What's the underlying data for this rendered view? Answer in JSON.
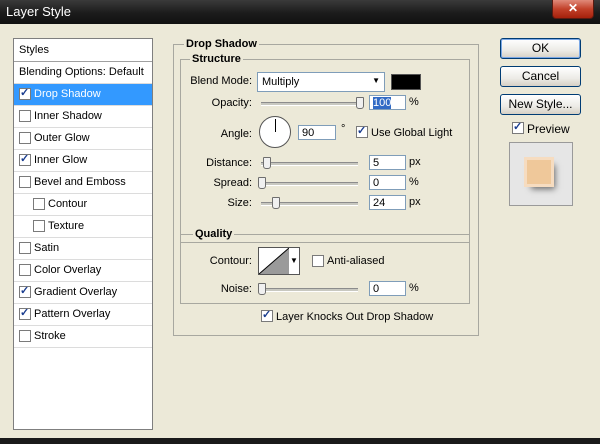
{
  "window": {
    "title": "Layer Style",
    "close_glyph": "✕"
  },
  "styles_panel": {
    "header": "Styles",
    "items": [
      {
        "label": "Blending Options: Default",
        "checkbox": false,
        "checked": false,
        "selected": false,
        "indent": 0
      },
      {
        "label": "Drop Shadow",
        "checkbox": true,
        "checked": true,
        "selected": true,
        "indent": 0
      },
      {
        "label": "Inner Shadow",
        "checkbox": true,
        "checked": false,
        "selected": false,
        "indent": 0
      },
      {
        "label": "Outer Glow",
        "checkbox": true,
        "checked": false,
        "selected": false,
        "indent": 0
      },
      {
        "label": "Inner Glow",
        "checkbox": true,
        "checked": true,
        "selected": false,
        "indent": 0
      },
      {
        "label": "Bevel and Emboss",
        "checkbox": true,
        "checked": false,
        "selected": false,
        "indent": 0
      },
      {
        "label": "Contour",
        "checkbox": true,
        "checked": false,
        "selected": false,
        "indent": 1
      },
      {
        "label": "Texture",
        "checkbox": true,
        "checked": false,
        "selected": false,
        "indent": 1
      },
      {
        "label": "Satin",
        "checkbox": true,
        "checked": false,
        "selected": false,
        "indent": 0
      },
      {
        "label": "Color Overlay",
        "checkbox": true,
        "checked": false,
        "selected": false,
        "indent": 0
      },
      {
        "label": "Gradient Overlay",
        "checkbox": true,
        "checked": true,
        "selected": false,
        "indent": 0
      },
      {
        "label": "Pattern Overlay",
        "checkbox": true,
        "checked": true,
        "selected": false,
        "indent": 0
      },
      {
        "label": "Stroke",
        "checkbox": true,
        "checked": false,
        "selected": false,
        "indent": 0
      }
    ]
  },
  "drop_shadow": {
    "group_title": "Drop Shadow",
    "structure": {
      "title": "Structure",
      "blend_mode_label": "Blend Mode:",
      "blend_mode_value": "Multiply",
      "shadow_color": "#000000",
      "opacity_label": "Opacity:",
      "opacity_value": "100",
      "opacity_unit": "%",
      "angle_label": "Angle:",
      "angle_value": "90",
      "angle_unit": "°",
      "use_global_light_label": "Use Global Light",
      "use_global_light": true,
      "distance_label": "Distance:",
      "distance_value": "5",
      "distance_unit": "px",
      "spread_label": "Spread:",
      "spread_value": "0",
      "spread_unit": "%",
      "size_label": "Size:",
      "size_value": "24",
      "size_unit": "px"
    },
    "quality": {
      "title": "Quality",
      "contour_label": "Contour:",
      "anti_aliased_label": "Anti-aliased",
      "anti_aliased": false,
      "noise_label": "Noise:",
      "noise_value": "0",
      "noise_unit": "%"
    },
    "knocks_out_label": "Layer Knocks Out Drop Shadow",
    "knocks_out": true
  },
  "buttons": {
    "ok": "OK",
    "cancel": "Cancel",
    "new_style": "New Style...",
    "preview_label": "Preview",
    "preview_checked": true
  },
  "colors": {
    "selection": "#3399ff",
    "preview_fill": "#efc89a"
  }
}
